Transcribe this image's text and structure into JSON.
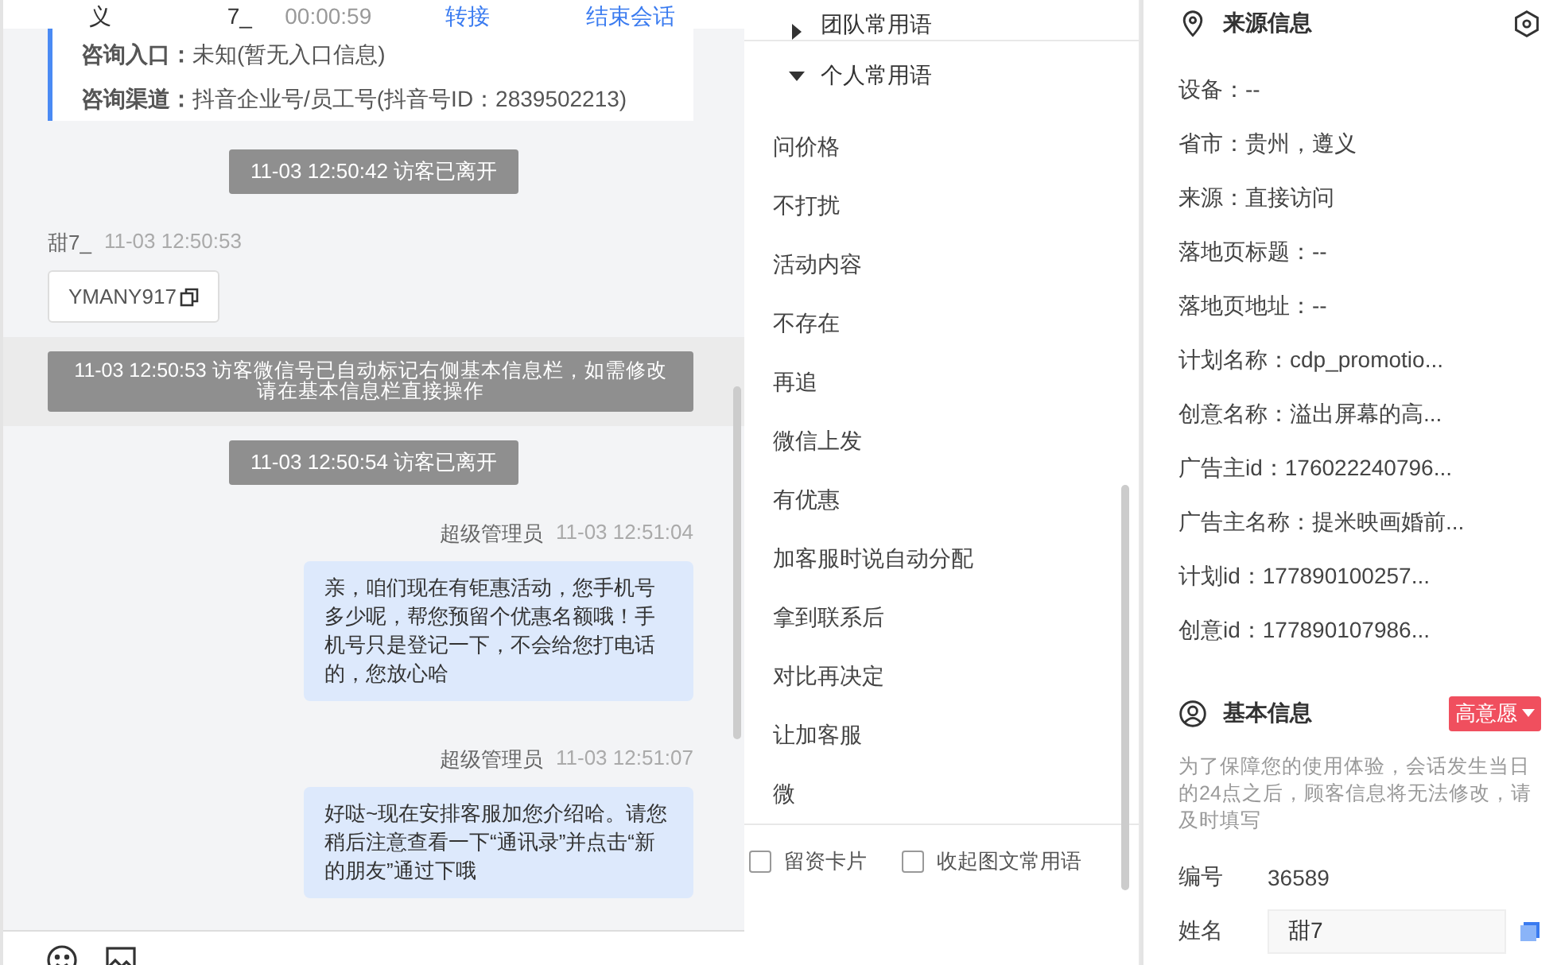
{
  "chat_header": {
    "cells": [
      "义",
      "7_",
      "00:00:59"
    ],
    "actions": [
      "转接",
      "结束会话"
    ]
  },
  "consult_card": {
    "rows": [
      {
        "label": "咨询入口：",
        "value": "未知(暂无入口信息)"
      },
      {
        "label": "咨询渠道：",
        "value": "抖音企业号/员工号(抖音号ID：2839502213)"
      }
    ]
  },
  "messages": [
    {
      "kind": "system",
      "text": "11-03 12:50:42 访客已离开"
    },
    {
      "kind": "visitor",
      "sender": "甜7_",
      "time": "11-03 12:50:53",
      "text": "YMANY917"
    },
    {
      "kind": "notice",
      "text": "11-03 12:50:53 访客微信号已自动标记右侧基本信息栏，如需修改请在基本信息栏直接操作"
    },
    {
      "kind": "system",
      "text": "11-03 12:50:54 访客已离开"
    },
    {
      "kind": "agent",
      "sender": "超级管理员",
      "time": "11-03 12:51:04",
      "text": "亲，咱们现在有钜惠活动，您手机号多少呢，帮您预留个优惠名额哦！手机号只是登记一下，不会给您打电话的，您放心哈"
    },
    {
      "kind": "agent",
      "sender": "超级管理员",
      "time": "11-03 12:51:07",
      "text": "好哒~现在安排客服加您介绍哈。请您稍后注意查看一下“通讯录”并点击“新的朋友”通过下哦"
    }
  ],
  "phrases": {
    "groups": [
      {
        "label": "团队常用语",
        "expanded": false
      },
      {
        "label": "个人常用语",
        "expanded": true
      }
    ],
    "items": [
      "问价格",
      "不打扰",
      "活动内容",
      "不存在",
      "再追",
      "微信上发",
      "有优惠",
      "加客服时说自动分配",
      "拿到联系后",
      "对比再决定",
      "让加客服",
      "微"
    ],
    "footer": [
      {
        "label": "留资卡片",
        "checked": false
      },
      {
        "label": "收起图文常用语",
        "checked": false
      }
    ]
  },
  "source_info": {
    "title": "来源信息",
    "rows": [
      "设备：--",
      "省市：贵州，遵义",
      "来源：直接访问",
      "落地页标题：--",
      "落地页地址：--",
      "计划名称：cdp_promotio...",
      "创意名称：溢出屏幕的高...",
      "广告主id：176022240796...",
      "广告主名称：提米映画婚前...",
      "计划id：177890100257...",
      "创意id：177890107986..."
    ]
  },
  "basic_info": {
    "title": "基本信息",
    "intent_tag": "高意愿",
    "note": "为了保障您的使用体验，会话发生当日的24点之后，顾客信息将无法修改，请及时填写",
    "fields": [
      {
        "kind": "text",
        "label": "编号",
        "value": "36589"
      },
      {
        "kind": "input",
        "label": "姓名",
        "value": "甜7"
      }
    ]
  }
}
